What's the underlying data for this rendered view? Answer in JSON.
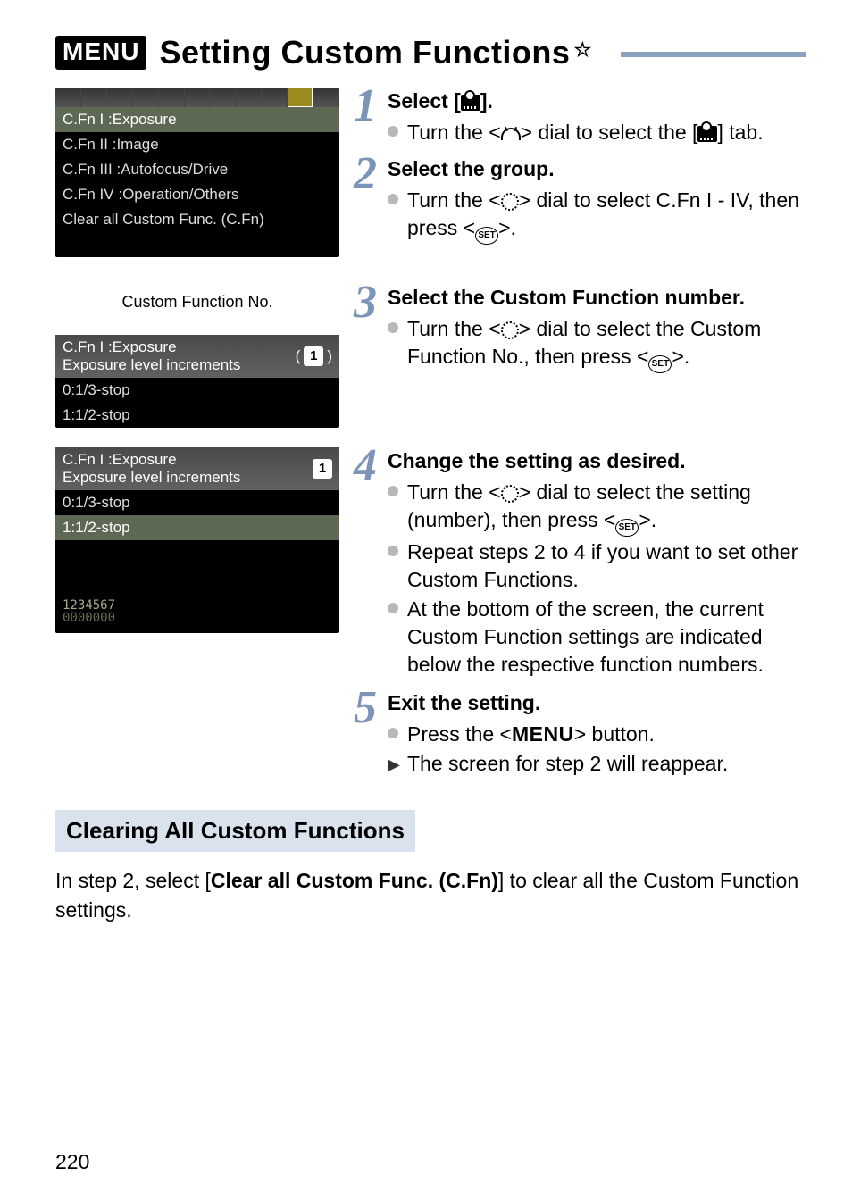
{
  "menu_badge": "MENU",
  "title": "Setting Custom Functions",
  "star": "☆",
  "screenshots": {
    "s1": {
      "rows": [
        "C.Fn I :Exposure",
        "C.Fn II :Image",
        "C.Fn III :Autofocus/Drive",
        "C.Fn IV :Operation/Others",
        "Clear all Custom Func. (C.Fn)"
      ]
    },
    "caption2": "Custom Function No.",
    "s2": {
      "header": "C.Fn I :Exposure",
      "sub": "Exposure level increments",
      "badge": "1",
      "rows": [
        "0:1/3-stop",
        "1:1/2-stop"
      ]
    },
    "s3": {
      "header": "C.Fn I :Exposure",
      "sub": "Exposure level increments",
      "badge": "1",
      "rows": [
        "0:1/3-stop",
        "1:1/2-stop"
      ],
      "footer_top": "1234567",
      "footer_bot": "0000000"
    }
  },
  "steps": {
    "s1": {
      "num": "1",
      "title_pre": "Select [",
      "title_post": "].",
      "b1_pre": "Turn the <",
      "b1_mid": "> dial to select the [",
      "b1_post": "] tab."
    },
    "s2": {
      "num": "2",
      "title": "Select the group.",
      "b1_pre": "Turn the <",
      "b1_mid": "> dial to select C.Fn I - IV, then press <",
      "b1_post": ">."
    },
    "s3": {
      "num": "3",
      "title": "Select the Custom Function number.",
      "b1_pre": "Turn the <",
      "b1_mid": "> dial to select the Custom Function No., then press <",
      "b1_post": ">."
    },
    "s4": {
      "num": "4",
      "title": "Change the setting as desired.",
      "b1_pre": "Turn the <",
      "b1_mid": "> dial to select the setting (number), then press <",
      "b1_post": ">.",
      "b2": "Repeat steps 2 to 4 if you want to set other Custom Functions.",
      "b3": "At the bottom of the screen, the current Custom Function settings are indicated below the respective function numbers."
    },
    "s5": {
      "num": "5",
      "title": "Exit the setting.",
      "b1_pre": "Press the <",
      "b1_mid": "MENU",
      "b1_post": "> button.",
      "b2": "The screen for step 2 will reappear."
    }
  },
  "clearing": {
    "header": "Clearing All Custom Functions",
    "text_pre": "In step 2, select [",
    "text_bold": "Clear all Custom Func. (C.Fn)",
    "text_post": "] to clear all the Custom Function settings."
  },
  "page_number": "220",
  "set_label": "SET"
}
